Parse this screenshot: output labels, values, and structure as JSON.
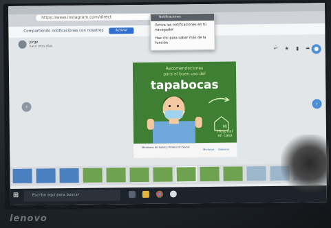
{
  "browser": {
    "url_text": "https://www.instagram.com/direct",
    "colors": {
      "tab_strip": "#b9bfc5",
      "url_bg": "#ffffff"
    }
  },
  "infobar": {
    "message": "Compartiendo notificaciones con nosotros",
    "button_label": "Activar"
  },
  "popup": {
    "header": "Notificaciones",
    "line1": "Activa las notificaciones en tu",
    "line2": "navegador",
    "line3": "Haz clic para saber más de la",
    "line4": "función"
  },
  "sender": {
    "name": "Jorge",
    "subtitle": "hace unos días"
  },
  "poster": {
    "line1": "Recomendaciones",
    "line2": "para el buen uso del",
    "title": "tapabocas",
    "brand": "Mi Hospital en casa",
    "footer_text": "Ministerio de Salud y Protección Social",
    "logo_left": "MinSalud",
    "logo_right": "Gobierno",
    "colors": {
      "background": "#3f7f34",
      "title": "#ffffff",
      "accent": "#c8e6a8"
    }
  },
  "viewer": {
    "nav_prev_icon": "chevron-left-icon",
    "nav_next_icon": "chevron-right-icon",
    "toolbar_icons": [
      "reply-icon",
      "star-icon",
      "delete-icon",
      "share-icon",
      "more-icon"
    ],
    "toolbar_glyphs": "↶ ★ ▮ ➦ ⋮"
  },
  "thumbnails": {
    "count": 13,
    "colors": [
      "#4a7fc0",
      "#4a7fc0",
      "#4a7fc0",
      "#6ea24f",
      "#6ea24f",
      "#6ea24f",
      "#6ea24f",
      "#6ea24f",
      "#6ea24f",
      "#6ea24f",
      "#9cb6cc",
      "#9cb6cc",
      "#9cb6cc"
    ]
  },
  "taskbar": {
    "search_placeholder": "Escribe aquí para buscar",
    "icons": [
      "task-view-icon",
      "file-explorer-icon",
      "chrome-icon",
      "settings-icon"
    ]
  },
  "laptop": {
    "brand": "lenovo"
  }
}
